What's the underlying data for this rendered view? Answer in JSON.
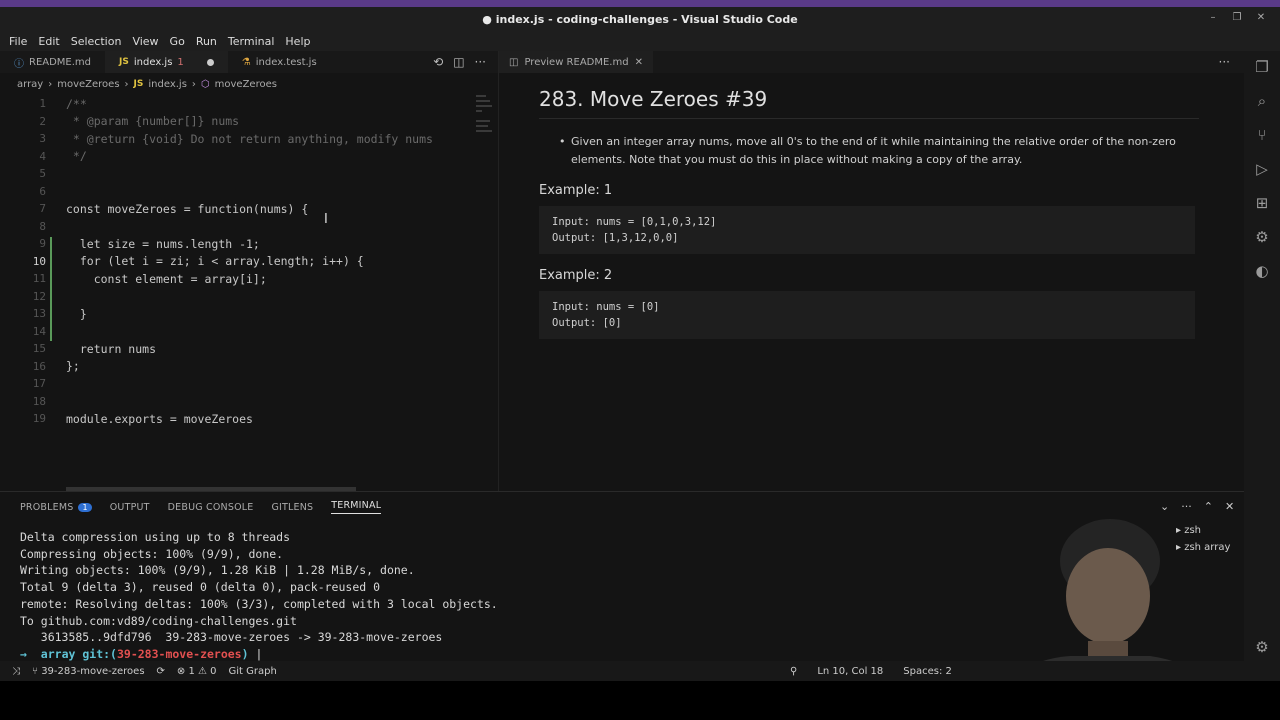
{
  "window": {
    "title": "● index.js - coding-challenges - Visual Studio Code"
  },
  "menu": [
    "File",
    "Edit",
    "Selection",
    "View",
    "Go",
    "Run",
    "Terminal",
    "Help"
  ],
  "editor_tabs": {
    "tab1": "README.md",
    "tab2_icon": "JS",
    "tab2": "index.js",
    "tab2_badge": "1",
    "tab3": "index.test.js"
  },
  "breadcrumb": {
    "part1": "array",
    "part2": "moveZeroes",
    "part3_icon": "JS",
    "part3": "index.js",
    "part4": "moveZeroes"
  },
  "code": {
    "lines": [
      {
        "n": "1",
        "t": "/**"
      },
      {
        "n": "2",
        "t": " * @param {number[]} nums"
      },
      {
        "n": "3",
        "t": " * @return {void} Do not return anything, modify nums"
      },
      {
        "n": "4",
        "t": " */"
      },
      {
        "n": "5",
        "t": ""
      },
      {
        "n": "6",
        "t": ""
      },
      {
        "n": "7",
        "t": "const moveZeroes = function(nums) {"
      },
      {
        "n": "8",
        "t": ""
      },
      {
        "n": "9",
        "t": "  let size = nums.length -1;"
      },
      {
        "n": "10",
        "t": "  for (let i = zi; i < array.length; i++) {"
      },
      {
        "n": "11",
        "t": "    const element = array[i];"
      },
      {
        "n": "12",
        "t": ""
      },
      {
        "n": "13",
        "t": "  }"
      },
      {
        "n": "14",
        "t": ""
      },
      {
        "n": "15",
        "t": "  return nums"
      },
      {
        "n": "16",
        "t": "};"
      },
      {
        "n": "17",
        "t": ""
      },
      {
        "n": "18",
        "t": ""
      },
      {
        "n": "19",
        "t": "module.exports = moveZeroes"
      }
    ]
  },
  "preview": {
    "tab": "Preview README.md",
    "title": "283. Move Zeroes #39",
    "bullet": "Given an integer array nums, move all 0's to the end of it while maintaining the relative order of the non-zero elements. Note that you must do this in place without making a copy of the array.",
    "ex1_title": "Example: 1",
    "ex1_input": "Input: nums = [0,1,0,3,12]",
    "ex1_output": "Output: [1,3,12,0,0]",
    "ex2_title": "Example: 2",
    "ex2_input": "Input: nums = [0]",
    "ex2_output": "Output: [0]"
  },
  "panel": {
    "tabs": [
      "PROBLEMS",
      "OUTPUT",
      "DEBUG CONSOLE",
      "GITLENS",
      "TERMINAL"
    ],
    "problems_count": "1",
    "terminal_lines": [
      "Delta compression using up to 8 threads",
      "Compressing objects: 100% (9/9), done.",
      "Writing objects: 100% (9/9), 1.28 KiB | 1.28 MiB/s, done.",
      "Total 9 (delta 3), reused 0 (delta 0), pack-reused 0",
      "remote: Resolving deltas: 100% (3/3), completed with 3 local objects.",
      "To github.com:vd89/coding-challenges.git",
      "   3613585..9dfd796  39-283-move-zeroes -> 39-283-move-zeroes"
    ],
    "prompt_arrow": "→",
    "prompt_dir": "array",
    "prompt_git": "git:(",
    "prompt_branch": "39-283-move-zeroes",
    "prompt_close": ")",
    "terminals": [
      "zsh",
      "zsh array"
    ]
  },
  "status": {
    "branch": "39-283-move-zeroes",
    "errors": "⊗ 1 ⚠ 0",
    "gitgraph": "Git Graph",
    "position": "Ln 10, Col 18",
    "spaces": "Spaces: 2"
  },
  "colors": {
    "accent": "#5a3a88",
    "badge": "#2e6fd1",
    "branch": "#e25050",
    "prompt": "#5fc3d6"
  }
}
